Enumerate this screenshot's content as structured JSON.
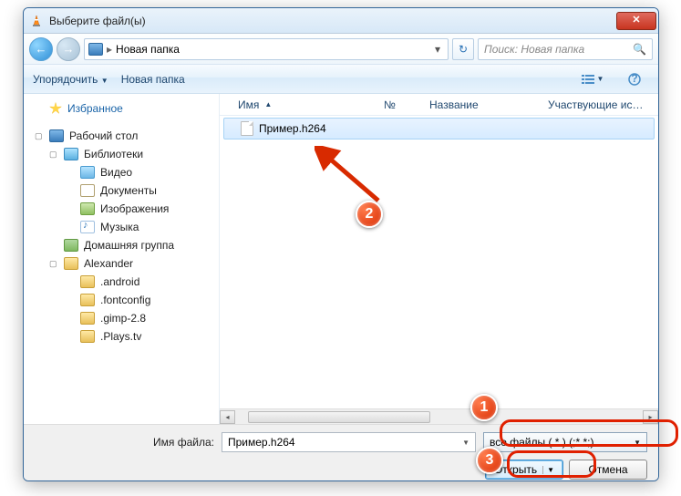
{
  "titlebar": {
    "title": "Выберите файл(ы)"
  },
  "nav": {
    "breadcrumb_sep": "▸",
    "breadcrumb": "Новая папка",
    "search_placeholder": "Поиск: Новая папка"
  },
  "toolbar": {
    "organize": "Упорядочить",
    "new_folder": "Новая папка"
  },
  "sidebar": {
    "favorites": "Избранное",
    "desktop": "Рабочий стол",
    "libraries": "Библиотеки",
    "video": "Видео",
    "documents": "Документы",
    "pictures": "Изображения",
    "music": "Музыка",
    "homegroup": "Домашняя группа",
    "user": "Alexander",
    "f_android": ".android",
    "f_fontconfig": ".fontconfig",
    "f_gimp": ".gimp-2.8",
    "f_plays": ".Plays.tv"
  },
  "columns": {
    "name": "Имя",
    "num": "№",
    "title": "Название",
    "contrib": "Участвующие ис…"
  },
  "file": {
    "name": "Пример.h264"
  },
  "bottom": {
    "filename_label": "Имя файла:",
    "filename_value": "Пример.h264",
    "filter": "все файлы ( * ) (;*.*;)",
    "open": "Открыть",
    "cancel": "Отмена"
  },
  "badges": {
    "b1": "1",
    "b2": "2",
    "b3": "3"
  }
}
